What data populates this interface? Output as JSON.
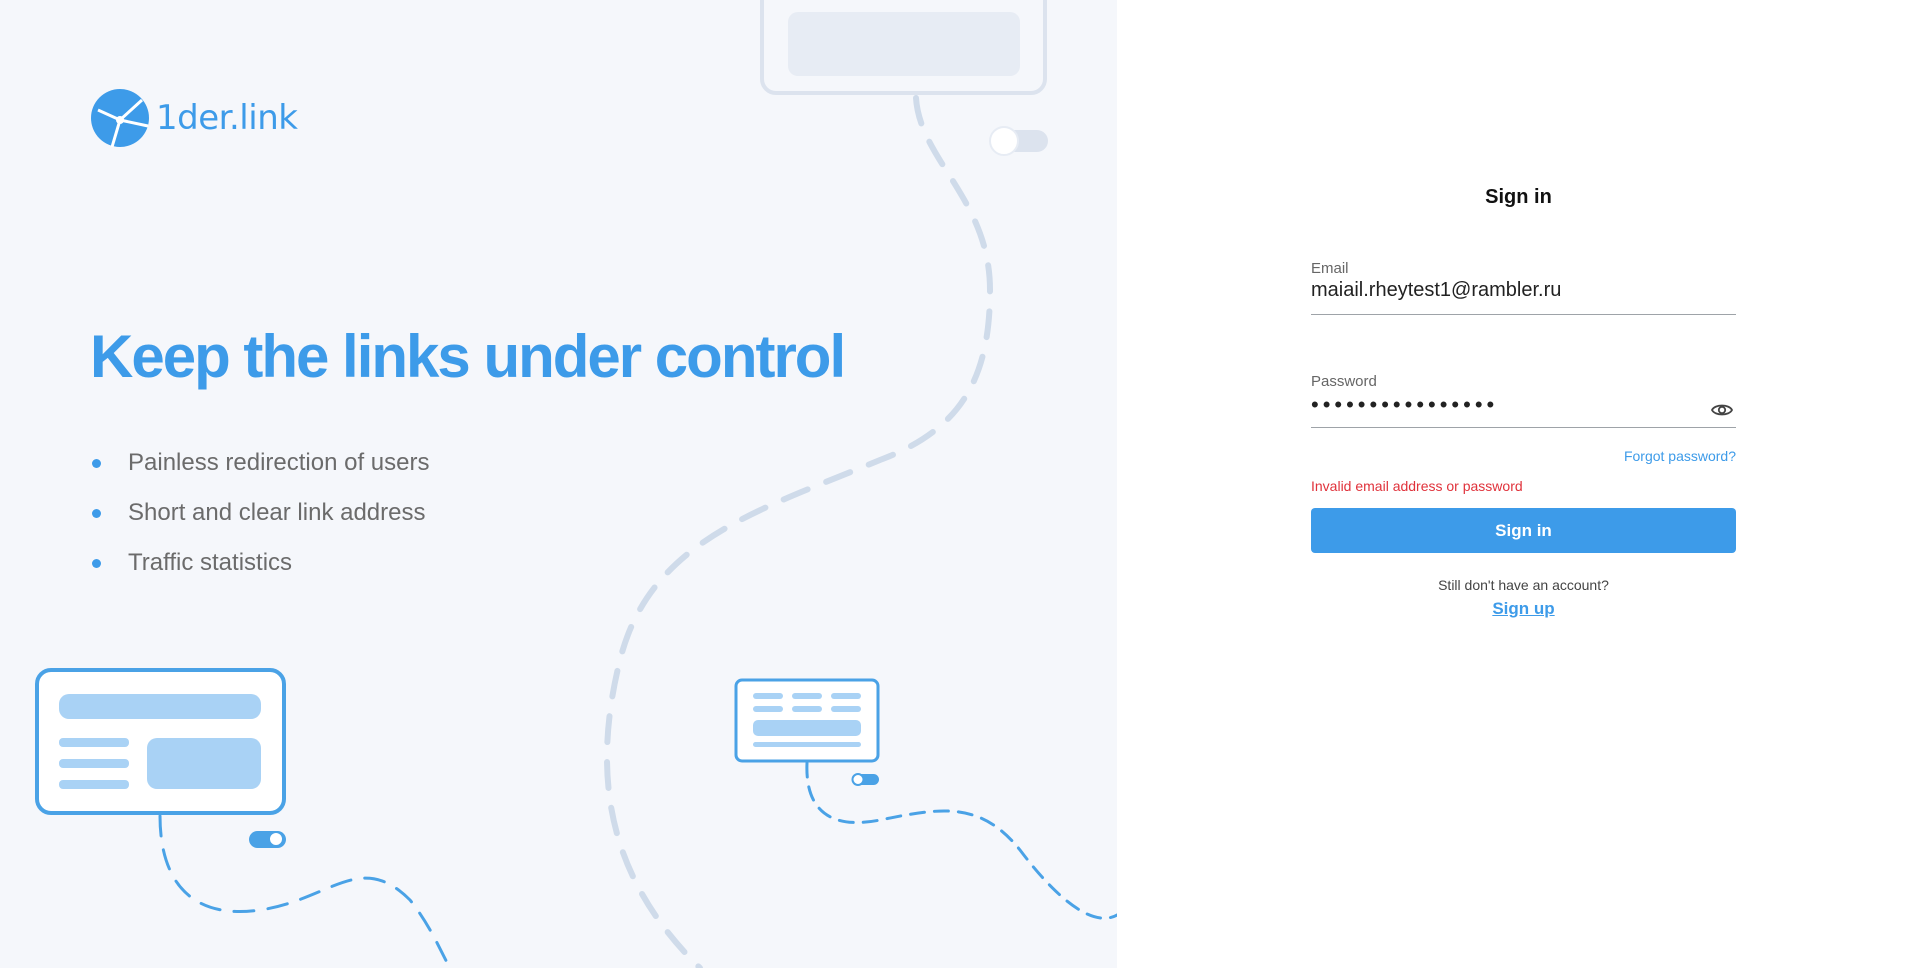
{
  "brand": {
    "logo_text": "1der.link",
    "logo_icon": "globe-link-icon",
    "accent_color": "#3d9be9",
    "error_color": "#e0323b"
  },
  "hero": {
    "headline": "Keep the links under control",
    "features": [
      "Painless redirection of users",
      "Short and clear link address",
      "Traffic statistics"
    ]
  },
  "signin": {
    "title": "Sign in",
    "email": {
      "label": "Email",
      "value": "maiail.rheytest1@rambler.ru"
    },
    "password": {
      "label": "Password",
      "value": "••••••••••••••••",
      "toggle_icon": "eye-icon"
    },
    "forgot_link": "Forgot password?",
    "error_message": "Invalid email address or password",
    "submit_label": "Sign in",
    "no_account_text": "Still don't have an account?",
    "signup_link": "Sign up"
  }
}
